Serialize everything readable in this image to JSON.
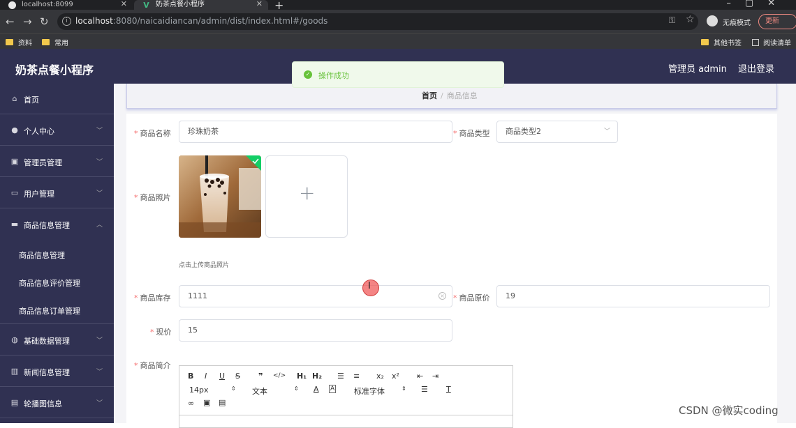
{
  "browser": {
    "tabs": [
      {
        "label": "localhost:8099",
        "close": "✕"
      },
      {
        "label": "奶茶点餐小程序",
        "close": "✕"
      }
    ],
    "new_tab": "+",
    "nav": {
      "back": "←",
      "forward": "→",
      "reload": "↻"
    },
    "url_host": "localhost",
    "url_rest": ":8080/naicaidiancan/admin/dist/index.html#/goods",
    "incognito_label": "无痕模式",
    "update_label": "更新",
    "bookmarks": [
      {
        "label": "资料"
      },
      {
        "label": "常用"
      },
      {
        "label": "其他书签"
      },
      {
        "label": "阅读清单"
      }
    ]
  },
  "header": {
    "title": "奶茶点餐小程序",
    "admin": "管理员 admin",
    "logout": "退出登录"
  },
  "toast": {
    "text": "操作成功",
    "color": "#67c23a"
  },
  "sidebar": {
    "items": [
      {
        "label": "首页",
        "icon": "home-icon"
      },
      {
        "label": "个人中心",
        "icon": "user-icon"
      },
      {
        "label": "管理员管理",
        "icon": "admin-icon"
      },
      {
        "label": "用户管理",
        "icon": "users-icon"
      },
      {
        "label": "商品信息管理",
        "icon": "goods-icon",
        "expanded": true
      },
      {
        "label": "基础数据管理",
        "icon": "data-icon"
      },
      {
        "label": "新闻信息管理",
        "icon": "news-icon"
      },
      {
        "label": "轮播图信息",
        "icon": "carousel-icon"
      }
    ],
    "sub_items": [
      {
        "label": "商品信息管理"
      },
      {
        "label": "商品信息评价管理"
      },
      {
        "label": "商品信息订单管理"
      }
    ]
  },
  "breadcrumb": {
    "home": "首页",
    "separator": "/",
    "current": "商品信息"
  },
  "form": {
    "name_label": "商品名称",
    "name_value": "珍珠奶茶",
    "type_label": "商品类型",
    "type_value": "商品类型2",
    "photo_label": "商品照片",
    "photo_hint": "点击上传商品照片",
    "stock_label": "商品库存",
    "stock_value": "1111",
    "orig_price_label": "商品原价",
    "orig_price_value": "19",
    "price_label": "现价",
    "price_value": "15",
    "intro_label": "商品简介"
  },
  "editor": {
    "buttons_row1": [
      "B",
      "I",
      "U",
      "S",
      "❞",
      "</>",
      "H₁",
      "H₂",
      "☰",
      "≡",
      "x₂",
      "x²",
      "⇤",
      "⇥"
    ],
    "font_size": "14px",
    "text_style": "文本",
    "font_family": "标准字体",
    "buttons_row3": [
      "link",
      "image",
      "video"
    ]
  },
  "watermark": "CSDN @微实coding"
}
